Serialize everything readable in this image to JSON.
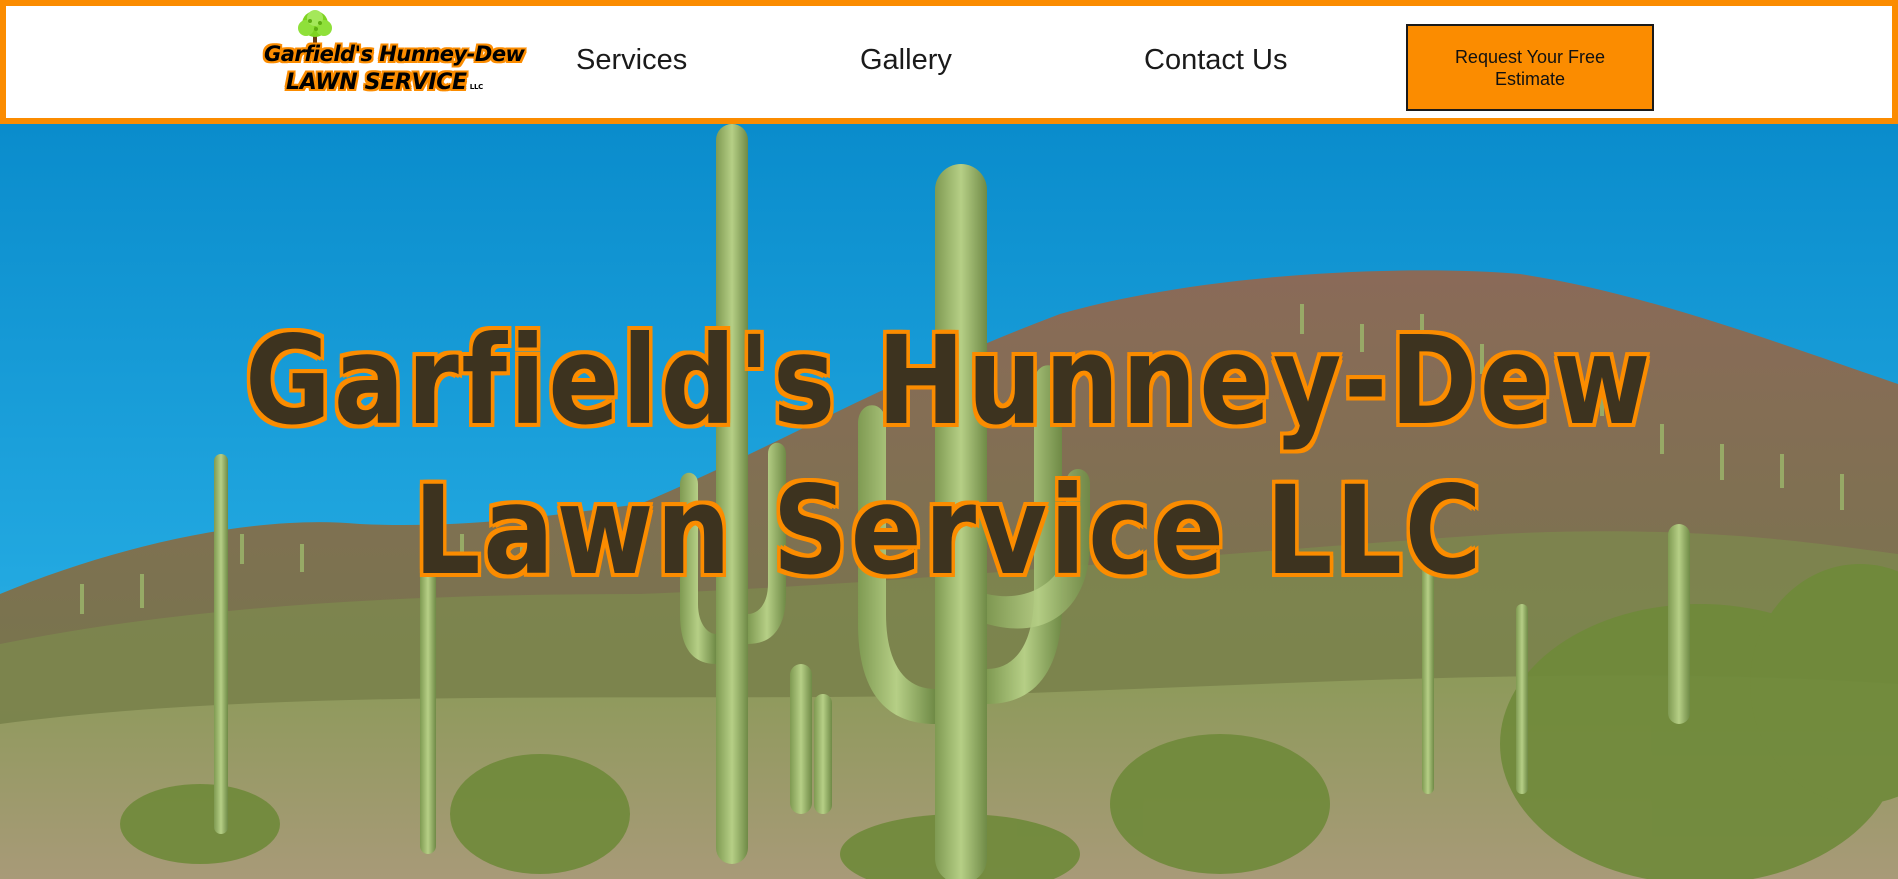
{
  "header": {
    "logo": {
      "line1": "Garfield's Hunney-Dew",
      "line2": "LAWN SERVICE",
      "suffix": "LLC"
    },
    "nav": [
      {
        "label": "Services"
      },
      {
        "label": "Gallery"
      },
      {
        "label": "Contact Us"
      }
    ],
    "cta_label": "Request Your Free Estimate"
  },
  "hero": {
    "title_line1": "Garfield's Hunney-Dew",
    "title_line2": "Lawn Service LLC"
  },
  "colors": {
    "accent": "#fb8c00",
    "sky": "#1a9fd8",
    "title_fill": "#122026"
  }
}
